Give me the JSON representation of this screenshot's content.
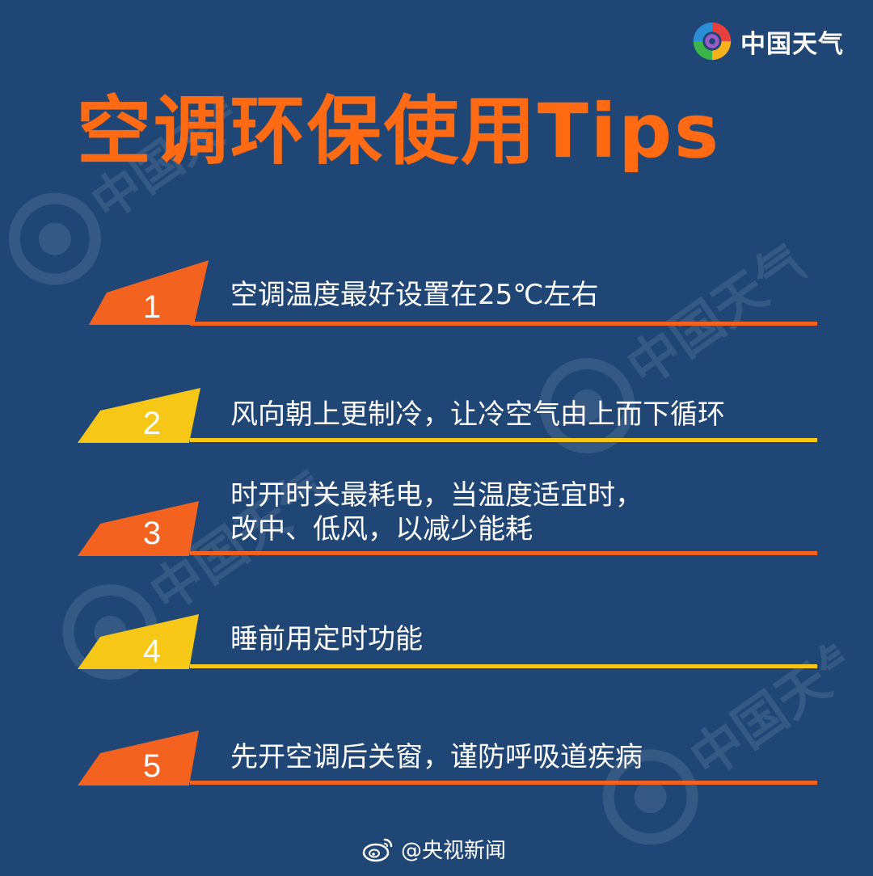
{
  "brand": {
    "name": "中国天气",
    "logo_icon": "rainbow-swirl-icon"
  },
  "title": "空调环保使用Tips",
  "watermark_text": "中国天气",
  "colors": {
    "background": "#1f4675",
    "orange": "#f4621f",
    "yellow": "#f7c718",
    "title": "#ff6a12"
  },
  "tips": [
    {
      "number": "1",
      "lines": [
        "空调温度最好设置在25℃左右"
      ],
      "color": "orange"
    },
    {
      "number": "2",
      "lines": [
        "风向朝上更制冷，让冷空气由上而下循环"
      ],
      "color": "yellow"
    },
    {
      "number": "3",
      "lines": [
        "时开时关最耗电，当温度适宜时，",
        "改中、低风，以减少能耗"
      ],
      "color": "orange"
    },
    {
      "number": "4",
      "lines": [
        "睡前用定时功能"
      ],
      "color": "yellow"
    },
    {
      "number": "5",
      "lines": [
        "先开空调后关窗，谨防呼吸道疾病"
      ],
      "color": "orange"
    }
  ],
  "footer": {
    "source": "@央视新闻",
    "icon": "weibo-icon"
  }
}
